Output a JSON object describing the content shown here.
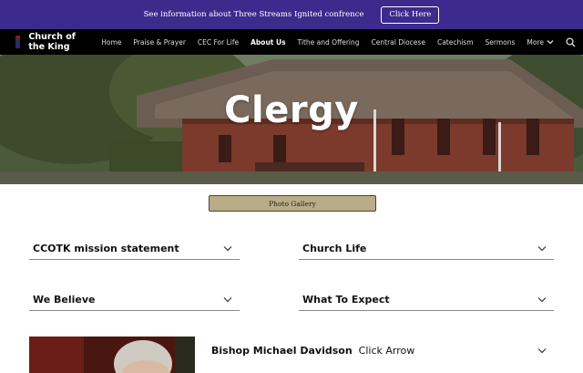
{
  "announcement": {
    "text": "See information about Three Streams Ignited confrence",
    "button_label": "Click Here"
  },
  "header": {
    "site_title": "Church of the King",
    "nav": [
      {
        "label": "Home"
      },
      {
        "label": "Praise & Prayer"
      },
      {
        "label": "CEC For Life"
      },
      {
        "label": "About Us",
        "active": true
      },
      {
        "label": "Tithe and Offering"
      },
      {
        "label": "Central Diocese"
      },
      {
        "label": "Catechism"
      },
      {
        "label": "Sermons"
      }
    ],
    "more_label": "More"
  },
  "hero": {
    "title": "Clergy"
  },
  "gallery_button": "Photo Gallery",
  "sections": [
    {
      "title": "CCOTK mission statement"
    },
    {
      "title": "Church Life"
    },
    {
      "title": "We Believe"
    },
    {
      "title": "What To Expect"
    }
  ],
  "clergy": [
    {
      "name": "Bishop Michael Davidson",
      "hint": "Click Arrow"
    }
  ],
  "colors": {
    "banner": "#3c2a8c",
    "nav": "#000000",
    "gallery_button": "#b9ac86"
  }
}
